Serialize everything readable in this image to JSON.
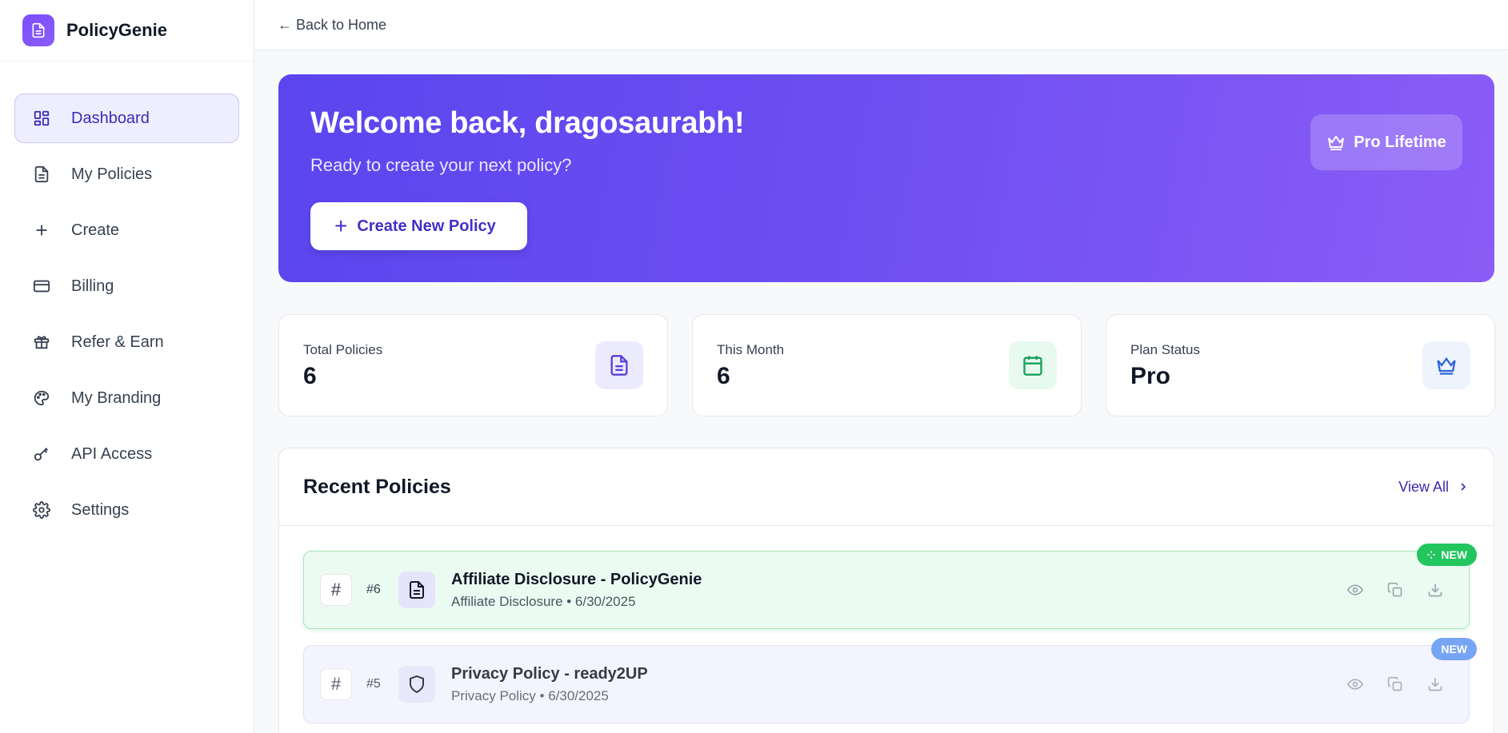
{
  "brand": {
    "name": "PolicyGenie"
  },
  "sidebar": {
    "items": [
      {
        "label": "Dashboard",
        "icon": "dashboard-icon"
      },
      {
        "label": "My Policies",
        "icon": "file-icon"
      },
      {
        "label": "Create",
        "icon": "plus-icon"
      },
      {
        "label": "Billing",
        "icon": "credit-card-icon"
      },
      {
        "label": "Refer & Earn",
        "icon": "gift-icon"
      },
      {
        "label": "My Branding",
        "icon": "palette-icon"
      },
      {
        "label": "API Access",
        "icon": "key-icon"
      },
      {
        "label": "Settings",
        "icon": "gear-icon"
      }
    ]
  },
  "topbar": {
    "back_label": "← Back to Home"
  },
  "hero": {
    "title": "Welcome back, dragosaurabh!",
    "subtitle": "Ready to create your next policy?",
    "create_button": "Create New Policy",
    "plan_badge": "Pro Lifetime"
  },
  "stats": [
    {
      "label": "Total Policies",
      "value": "6",
      "icon": "file-icon"
    },
    {
      "label": "This Month",
      "value": "6",
      "icon": "calendar-icon"
    },
    {
      "label": "Plan Status",
      "value": "Pro",
      "icon": "crown-icon"
    }
  ],
  "recent": {
    "title": "Recent Policies",
    "view_all": "View All",
    "items": [
      {
        "hash": "#",
        "num": "#6",
        "title": "Affiliate Disclosure - PolicyGenie",
        "meta": "Affiliate Disclosure • 6/30/2025",
        "badge": "NEW",
        "icon": "file-icon"
      },
      {
        "hash": "#",
        "num": "#5",
        "title": "Privacy Policy - ready2UP",
        "meta": "Privacy Policy • 6/30/2025",
        "badge": "NEW",
        "icon": "shield-icon"
      }
    ]
  },
  "colors": {
    "accent": "#5b45ee",
    "accent_end": "#8b5cf6",
    "success": "#22c55e",
    "info": "#6096f5"
  }
}
